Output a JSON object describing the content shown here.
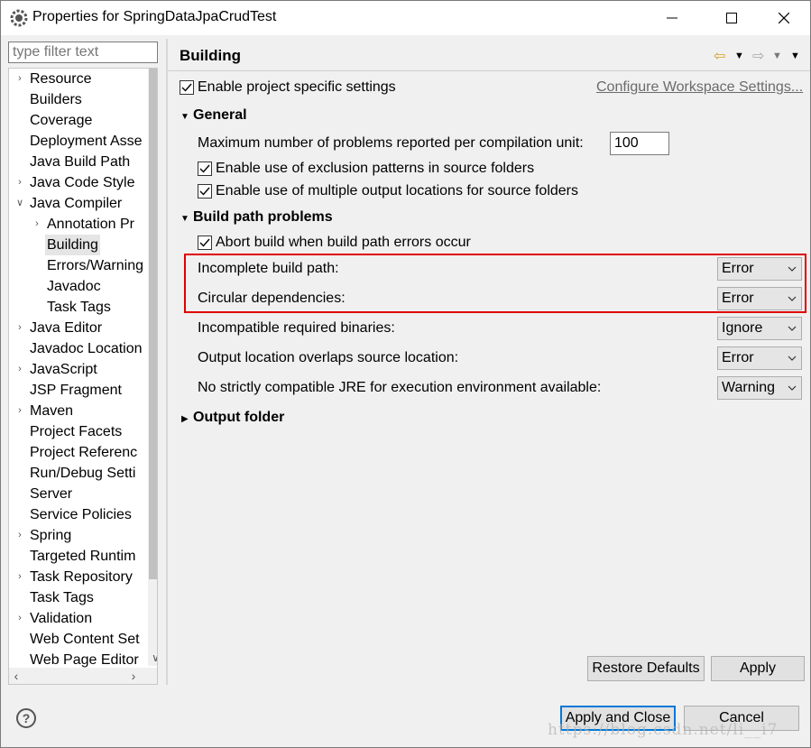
{
  "window": {
    "title": "Properties for SpringDataJpaCrudTest",
    "minimize_icon": "minimize-icon",
    "maximize_icon": "maximize-icon",
    "close_icon": "close-icon"
  },
  "filter": {
    "placeholder": "type filter text"
  },
  "tree": {
    "items": [
      {
        "label": "Resource",
        "expander": "collapsed"
      },
      {
        "label": "Builders",
        "expander": "none"
      },
      {
        "label": "Coverage",
        "expander": "none"
      },
      {
        "label": "Deployment Asse",
        "expander": "none"
      },
      {
        "label": "Java Build Path",
        "expander": "none"
      },
      {
        "label": "Java Code Style",
        "expander": "collapsed"
      },
      {
        "label": "Java Compiler",
        "expander": "expanded"
      },
      {
        "label": "Annotation Pr",
        "expander": "collapsed"
      },
      {
        "label": "Building",
        "expander": "none",
        "selected": true
      },
      {
        "label": "Errors/Warning",
        "expander": "none"
      },
      {
        "label": "Javadoc",
        "expander": "none"
      },
      {
        "label": "Task Tags",
        "expander": "none"
      },
      {
        "label": "Java Editor",
        "expander": "collapsed"
      },
      {
        "label": "Javadoc Location",
        "expander": "none"
      },
      {
        "label": "JavaScript",
        "expander": "collapsed"
      },
      {
        "label": "JSP Fragment",
        "expander": "none"
      },
      {
        "label": "Maven",
        "expander": "collapsed"
      },
      {
        "label": "Project Facets",
        "expander": "none"
      },
      {
        "label": "Project Referenc",
        "expander": "none"
      },
      {
        "label": "Run/Debug Setti",
        "expander": "none"
      },
      {
        "label": "Server",
        "expander": "none"
      },
      {
        "label": "Service Policies",
        "expander": "none"
      },
      {
        "label": "Spring",
        "expander": "collapsed"
      },
      {
        "label": "Targeted Runtim",
        "expander": "none"
      },
      {
        "label": "Task Repository",
        "expander": "collapsed"
      },
      {
        "label": "Task Tags",
        "expander": "none"
      },
      {
        "label": "Validation",
        "expander": "collapsed"
      },
      {
        "label": "Web Content Set",
        "expander": "none"
      },
      {
        "label": "Web Page Editor",
        "expander": "none"
      }
    ]
  },
  "page": {
    "title": "Building",
    "enable_project_specific": "Enable project specific settings",
    "configure_workspace": "Configure Workspace Settings...",
    "general": {
      "heading": "General",
      "max_problems_label": "Maximum number of problems reported per compilation unit:",
      "max_problems_value": "100",
      "exclusion_patterns": "Enable use of exclusion patterns in source folders",
      "multiple_output": "Enable use of multiple output locations for source folders"
    },
    "build_path": {
      "heading": "Build path problems",
      "abort_build": "Abort build when build path errors occur",
      "rows": [
        {
          "label": "Incomplete build path:",
          "value": "Error"
        },
        {
          "label": "Circular dependencies:",
          "value": "Error"
        },
        {
          "label": "Incompatible required binaries:",
          "value": "Ignore"
        },
        {
          "label": "Output location overlaps source location:",
          "value": "Error"
        },
        {
          "label": "No strictly compatible JRE for execution environment available:",
          "value": "Warning"
        }
      ]
    },
    "output_folder": {
      "heading": "Output folder"
    },
    "highlight_color": "#e00000"
  },
  "buttons": {
    "restore_defaults": "Restore Defaults",
    "apply": "Apply",
    "apply_and_close": "Apply and Close",
    "cancel": "Cancel"
  },
  "watermark": "https://blog.csdn.net/li__i7"
}
